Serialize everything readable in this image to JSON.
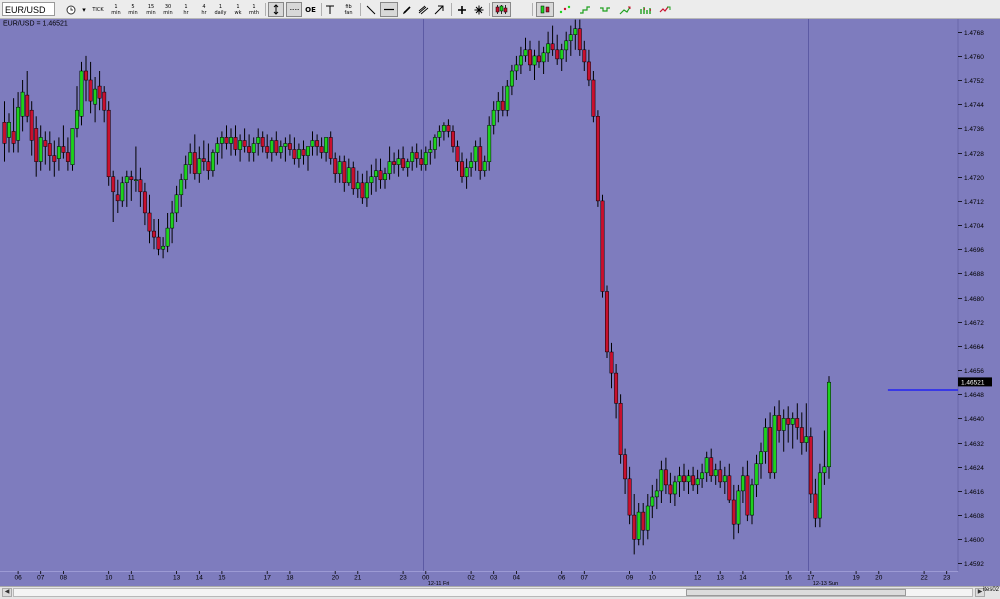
{
  "toolbar": {
    "symbol_value": "EUR/USD",
    "buttons": [
      {
        "name": "clock-icon",
        "label": ""
      },
      {
        "name": "dropdown-arrow-icon",
        "label": "▾"
      },
      {
        "name": "tick-button",
        "label": "TICK"
      },
      {
        "name": "1min-button",
        "label": "1\nmin"
      },
      {
        "name": "5min-button",
        "label": "5\nmin"
      },
      {
        "name": "15min-button",
        "label": "15\nmin"
      },
      {
        "name": "30min-button",
        "label": "30\nmin"
      },
      {
        "name": "1hr-button",
        "label": "1\nhr"
      },
      {
        "name": "4hr-button",
        "label": "4\nhr"
      },
      {
        "name": "1day-button",
        "label": "1\ndaily"
      },
      {
        "name": "1wk-button",
        "label": "1\nwk"
      },
      {
        "name": "1mth-button",
        "label": "1\nmth"
      }
    ],
    "oe_label": "OE",
    "fib_label": "fib\nfan"
  },
  "chart": {
    "title": "EUR/USD = 1.46521",
    "current_price_label": "1.46521",
    "corner_label": "ites02",
    "colors": {
      "background": "#7e7cbe",
      "up": "#1ed21e",
      "down": "#c8102e",
      "grid": "#8a88c8",
      "session_line": "#5c5aa4",
      "hline": "#1010ff"
    }
  },
  "chart_data": {
    "type": "candlestick",
    "title": "EUR/USD = 1.46521",
    "y_ticks": [
      1.4768,
      1.476,
      1.4752,
      1.4744,
      1.4736,
      1.4728,
      1.472,
      1.4712,
      1.4704,
      1.4696,
      1.4688,
      1.468,
      1.4672,
      1.4664,
      1.4656,
      1.4648,
      1.464,
      1.4632,
      1.4624,
      1.4616,
      1.4608,
      1.46,
      1.4592
    ],
    "ylim": [
      1.45895,
      1.47722
    ],
    "x_tick_labels": [
      {
        "label": "06",
        "slot": 3
      },
      {
        "label": "07",
        "slot": 8
      },
      {
        "label": "08",
        "slot": 13
      },
      {
        "label": "10",
        "slot": 23
      },
      {
        "label": "11",
        "slot": 28
      },
      {
        "label": "13",
        "slot": 38
      },
      {
        "label": "14",
        "slot": 43
      },
      {
        "label": "15",
        "slot": 48
      },
      {
        "label": "17",
        "slot": 58
      },
      {
        "label": "18",
        "slot": 63
      },
      {
        "label": "20",
        "slot": 73
      },
      {
        "label": "21",
        "slot": 78
      },
      {
        "label": "23",
        "slot": 88
      },
      {
        "label": "00",
        "slot": 93
      },
      {
        "label": "02",
        "slot": 103
      },
      {
        "label": "03",
        "slot": 108
      },
      {
        "label": "04",
        "slot": 113
      },
      {
        "label": "06",
        "slot": 123
      },
      {
        "label": "07",
        "slot": 128
      },
      {
        "label": "09",
        "slot": 138
      },
      {
        "label": "10",
        "slot": 143
      },
      {
        "label": "12",
        "slot": 153
      },
      {
        "label": "13",
        "slot": 158
      },
      {
        "label": "14",
        "slot": 163
      },
      {
        "label": "16",
        "slot": 173
      },
      {
        "label": "17",
        "slot": 178
      },
      {
        "label": "19",
        "slot": 188
      },
      {
        "label": "20",
        "slot": 193
      },
      {
        "label": "22",
        "slot": 203
      },
      {
        "label": "23",
        "slot": 208
      }
    ],
    "date_labels": [
      {
        "label": "12-11 Fri",
        "slot": 93
      },
      {
        "label": "12-13 Sun",
        "slot": 178
      }
    ],
    "session_separators": [
      92.3,
      177.3
    ],
    "current_price": 1.46521,
    "hline": {
      "y": 1.46494,
      "from_slot": 195,
      "to_slot": 211
    },
    "candles": [
      [
        1.4738,
        1.4745,
        1.4725,
        1.4731
      ],
      [
        1.4733,
        1.4741,
        1.4728,
        1.4738
      ],
      [
        1.4735,
        1.4746,
        1.4728,
        1.4731
      ],
      [
        1.4732,
        1.4748,
        1.4728,
        1.4743
      ],
      [
        1.474,
        1.4752,
        1.4735,
        1.4748
      ],
      [
        1.4747,
        1.4755,
        1.4738,
        1.474
      ],
      [
        1.4742,
        1.4745,
        1.4727,
        1.4732
      ],
      [
        1.4736,
        1.474,
        1.472,
        1.4725
      ],
      [
        1.4725,
        1.4737,
        1.4722,
        1.4733
      ],
      [
        1.4732,
        1.4735,
        1.4724,
        1.473
      ],
      [
        1.4731,
        1.4735,
        1.4722,
        1.4727
      ],
      [
        1.4727,
        1.4732,
        1.472,
        1.4725
      ],
      [
        1.4726,
        1.4733,
        1.4722,
        1.473
      ],
      [
        1.473,
        1.4737,
        1.4726,
        1.4728
      ],
      [
        1.4728,
        1.4733,
        1.4722,
        1.4725
      ],
      [
        1.4724,
        1.4736,
        1.4722,
        1.4736
      ],
      [
        1.4736,
        1.475,
        1.4733,
        1.4742
      ],
      [
        1.474,
        1.4758,
        1.4737,
        1.4755
      ],
      [
        1.4755,
        1.476,
        1.4745,
        1.4752
      ],
      [
        1.4752,
        1.4758,
        1.4741,
        1.4745
      ],
      [
        1.4744,
        1.4753,
        1.4738,
        1.4749
      ],
      [
        1.475,
        1.4755,
        1.4742,
        1.4746
      ],
      [
        1.4748,
        1.475,
        1.4738,
        1.4742
      ],
      [
        1.4742,
        1.4745,
        1.4717,
        1.472
      ],
      [
        1.472,
        1.4722,
        1.4705,
        1.4715
      ],
      [
        1.4714,
        1.4719,
        1.4708,
        1.4712
      ],
      [
        1.4712,
        1.472,
        1.471,
        1.4718
      ],
      [
        1.4718,
        1.4722,
        1.471,
        1.472
      ],
      [
        1.472,
        1.4722,
        1.4712,
        1.4719
      ],
      [
        1.4719,
        1.473,
        1.4715,
        1.4719
      ],
      [
        1.4719,
        1.4723,
        1.471,
        1.4715
      ],
      [
        1.4715,
        1.4718,
        1.4704,
        1.4708
      ],
      [
        1.4708,
        1.4714,
        1.4698,
        1.4702
      ],
      [
        1.4702,
        1.4706,
        1.4696,
        1.47
      ],
      [
        1.47,
        1.4706,
        1.4694,
        1.4696
      ],
      [
        1.4696,
        1.47,
        1.4693,
        1.4697
      ],
      [
        1.4697,
        1.4708,
        1.4695,
        1.4703
      ],
      [
        1.4703,
        1.4712,
        1.4698,
        1.4708
      ],
      [
        1.4708,
        1.4717,
        1.4705,
        1.4714
      ],
      [
        1.4714,
        1.4721,
        1.471,
        1.4719
      ],
      [
        1.4719,
        1.4727,
        1.4716,
        1.4724
      ],
      [
        1.4724,
        1.4731,
        1.4721,
        1.4728
      ],
      [
        1.4728,
        1.4734,
        1.4719,
        1.4721
      ],
      [
        1.4721,
        1.473,
        1.4718,
        1.4726
      ],
      [
        1.4726,
        1.4732,
        1.4722,
        1.4725
      ],
      [
        1.4725,
        1.4731,
        1.4719,
        1.4722
      ],
      [
        1.4722,
        1.4729,
        1.472,
        1.4728
      ],
      [
        1.4728,
        1.4733,
        1.4724,
        1.4731
      ],
      [
        1.4731,
        1.4735,
        1.4726,
        1.4733
      ],
      [
        1.4733,
        1.4737,
        1.4729,
        1.4731
      ],
      [
        1.4731,
        1.4736,
        1.4727,
        1.4733
      ],
      [
        1.4733,
        1.4737,
        1.4727,
        1.4729
      ],
      [
        1.4729,
        1.4734,
        1.4725,
        1.4732
      ],
      [
        1.4732,
        1.4736,
        1.4728,
        1.473
      ],
      [
        1.473,
        1.4734,
        1.4725,
        1.4728
      ],
      [
        1.4728,
        1.4733,
        1.4725,
        1.4731
      ],
      [
        1.4731,
        1.4736,
        1.4727,
        1.4733
      ],
      [
        1.4733,
        1.4735,
        1.4728,
        1.473
      ],
      [
        1.473,
        1.4734,
        1.4726,
        1.4728
      ],
      [
        1.4728,
        1.4733,
        1.4725,
        1.4732
      ],
      [
        1.4732,
        1.4735,
        1.4727,
        1.4728
      ],
      [
        1.4728,
        1.4732,
        1.4726,
        1.473
      ],
      [
        1.473,
        1.4733,
        1.4725,
        1.4731
      ],
      [
        1.4731,
        1.4734,
        1.4727,
        1.4729
      ],
      [
        1.4729,
        1.4733,
        1.4724,
        1.4726
      ],
      [
        1.4726,
        1.4731,
        1.4723,
        1.4729
      ],
      [
        1.4729,
        1.4732,
        1.4724,
        1.4727
      ],
      [
        1.4727,
        1.473,
        1.4722,
        1.473
      ],
      [
        1.473,
        1.4735,
        1.4727,
        1.4732
      ],
      [
        1.4732,
        1.4734,
        1.4727,
        1.473
      ],
      [
        1.473,
        1.4733,
        1.4726,
        1.4728
      ],
      [
        1.4728,
        1.4733,
        1.4725,
        1.4733
      ],
      [
        1.4733,
        1.4735,
        1.4724,
        1.4726
      ],
      [
        1.4726,
        1.4728,
        1.4718,
        1.4721
      ],
      [
        1.4721,
        1.4727,
        1.4718,
        1.4725
      ],
      [
        1.4725,
        1.4727,
        1.4715,
        1.4718
      ],
      [
        1.4718,
        1.4726,
        1.4717,
        1.4723
      ],
      [
        1.4723,
        1.4725,
        1.4714,
        1.4716
      ],
      [
        1.4716,
        1.4722,
        1.4713,
        1.4718
      ],
      [
        1.4718,
        1.4721,
        1.4711,
        1.4713
      ],
      [
        1.4713,
        1.4722,
        1.471,
        1.4718
      ],
      [
        1.4718,
        1.4724,
        1.4714,
        1.472
      ],
      [
        1.472,
        1.4726,
        1.4715,
        1.4722
      ],
      [
        1.4722,
        1.4726,
        1.4716,
        1.4719
      ],
      [
        1.4719,
        1.4723,
        1.4716,
        1.4721
      ],
      [
        1.4721,
        1.473,
        1.4719,
        1.4725
      ],
      [
        1.4725,
        1.4728,
        1.4721,
        1.4724
      ],
      [
        1.4724,
        1.4729,
        1.472,
        1.4726
      ],
      [
        1.4726,
        1.473,
        1.4722,
        1.4723
      ],
      [
        1.4723,
        1.4726,
        1.472,
        1.4725
      ],
      [
        1.4725,
        1.473,
        1.4722,
        1.4728
      ],
      [
        1.4728,
        1.4731,
        1.4723,
        1.4726
      ],
      [
        1.4726,
        1.4729,
        1.4722,
        1.4724
      ],
      [
        1.4724,
        1.473,
        1.4722,
        1.4728
      ],
      [
        1.4728,
        1.4732,
        1.4724,
        1.4729
      ],
      [
        1.4729,
        1.4734,
        1.4726,
        1.4733
      ],
      [
        1.4733,
        1.4737,
        1.473,
        1.4735
      ],
      [
        1.4735,
        1.4738,
        1.4732,
        1.4737
      ],
      [
        1.4737,
        1.4739,
        1.4733,
        1.4735
      ],
      [
        1.4735,
        1.4737,
        1.4728,
        1.473
      ],
      [
        1.473,
        1.4732,
        1.4722,
        1.4725
      ],
      [
        1.4725,
        1.4728,
        1.4718,
        1.472
      ],
      [
        1.472,
        1.4726,
        1.4716,
        1.4723
      ],
      [
        1.4723,
        1.4728,
        1.472,
        1.4725
      ],
      [
        1.4725,
        1.4732,
        1.4722,
        1.473
      ],
      [
        1.473,
        1.4733,
        1.4719,
        1.4722
      ],
      [
        1.4722,
        1.4727,
        1.472,
        1.4725
      ],
      [
        1.4725,
        1.474,
        1.4722,
        1.4737
      ],
      [
        1.4737,
        1.4745,
        1.4734,
        1.4742
      ],
      [
        1.4742,
        1.4748,
        1.4738,
        1.4745
      ],
      [
        1.4745,
        1.475,
        1.474,
        1.4742
      ],
      [
        1.4742,
        1.4752,
        1.474,
        1.475
      ],
      [
        1.475,
        1.4757,
        1.4747,
        1.4755
      ],
      [
        1.4755,
        1.476,
        1.4752,
        1.4757
      ],
      [
        1.4757,
        1.4763,
        1.4754,
        1.476
      ],
      [
        1.476,
        1.4766,
        1.4758,
        1.4762
      ],
      [
        1.4762,
        1.4765,
        1.4755,
        1.4757
      ],
      [
        1.4757,
        1.4762,
        1.4752,
        1.476
      ],
      [
        1.476,
        1.4765,
        1.4756,
        1.4758
      ],
      [
        1.4758,
        1.4763,
        1.4754,
        1.4761
      ],
      [
        1.4761,
        1.4768,
        1.4758,
        1.4764
      ],
      [
        1.4764,
        1.477,
        1.476,
        1.4762
      ],
      [
        1.4762,
        1.4767,
        1.4757,
        1.4759
      ],
      [
        1.4759,
        1.4764,
        1.4755,
        1.4762
      ],
      [
        1.4762,
        1.4768,
        1.4758,
        1.4765
      ],
      [
        1.4765,
        1.477,
        1.476,
        1.4767
      ],
      [
        1.4767,
        1.4772,
        1.4762,
        1.4769
      ],
      [
        1.4769,
        1.4772,
        1.476,
        1.4762
      ],
      [
        1.4762,
        1.4765,
        1.4755,
        1.4758
      ],
      [
        1.4758,
        1.4762,
        1.475,
        1.4752
      ],
      [
        1.4752,
        1.4755,
        1.4738,
        1.474
      ],
      [
        1.474,
        1.4742,
        1.471,
        1.4712
      ],
      [
        1.4712,
        1.4714,
        1.468,
        1.4682
      ],
      [
        1.4682,
        1.4684,
        1.466,
        1.4662
      ],
      [
        1.4662,
        1.4665,
        1.465,
        1.4655
      ],
      [
        1.4655,
        1.4658,
        1.464,
        1.4645
      ],
      [
        1.4645,
        1.4648,
        1.4625,
        1.4628
      ],
      [
        1.4628,
        1.463,
        1.4615,
        1.462
      ],
      [
        1.462,
        1.4624,
        1.4605,
        1.4608
      ],
      [
        1.4608,
        1.4615,
        1.4595,
        1.46
      ],
      [
        1.46,
        1.4612,
        1.4598,
        1.4609
      ],
      [
        1.4609,
        1.4612,
        1.4598,
        1.4603
      ],
      [
        1.4603,
        1.4615,
        1.46,
        1.4611
      ],
      [
        1.4611,
        1.4618,
        1.4607,
        1.4614
      ],
      [
        1.4614,
        1.462,
        1.461,
        1.4616
      ],
      [
        1.4616,
        1.4626,
        1.4612,
        1.4623
      ],
      [
        1.4623,
        1.4627,
        1.4615,
        1.4618
      ],
      [
        1.4618,
        1.4622,
        1.4612,
        1.4615
      ],
      [
        1.4615,
        1.4621,
        1.4611,
        1.4619
      ],
      [
        1.4619,
        1.4624,
        1.4614,
        1.4621
      ],
      [
        1.4621,
        1.4625,
        1.4616,
        1.4619
      ],
      [
        1.4619,
        1.4623,
        1.4615,
        1.4621
      ],
      [
        1.4621,
        1.4624,
        1.4616,
        1.4618
      ],
      [
        1.4618,
        1.4623,
        1.4615,
        1.462
      ],
      [
        1.462,
        1.4625,
        1.4617,
        1.4622
      ],
      [
        1.4622,
        1.4629,
        1.4619,
        1.4627
      ],
      [
        1.4627,
        1.463,
        1.4619,
        1.4621
      ],
      [
        1.4621,
        1.4625,
        1.4618,
        1.4623
      ],
      [
        1.4623,
        1.4626,
        1.4617,
        1.4619
      ],
      [
        1.4619,
        1.4624,
        1.4615,
        1.4621
      ],
      [
        1.4621,
        1.4625,
        1.4612,
        1.4613
      ],
      [
        1.4613,
        1.4618,
        1.46,
        1.4605
      ],
      [
        1.4605,
        1.4618,
        1.4602,
        1.4616
      ],
      [
        1.4616,
        1.4624,
        1.4612,
        1.4621
      ],
      [
        1.4621,
        1.4626,
        1.4606,
        1.4608
      ],
      [
        1.4608,
        1.462,
        1.4605,
        1.4618
      ],
      [
        1.4618,
        1.4628,
        1.4614,
        1.4625
      ],
      [
        1.4625,
        1.4632,
        1.462,
        1.4629
      ],
      [
        1.4629,
        1.464,
        1.4625,
        1.4637
      ],
      [
        1.4637,
        1.4642,
        1.462,
        1.4622
      ],
      [
        1.4622,
        1.4644,
        1.462,
        1.4641
      ],
      [
        1.4641,
        1.4646,
        1.4632,
        1.4636
      ],
      [
        1.4636,
        1.4643,
        1.4629,
        1.464
      ],
      [
        1.464,
        1.4644,
        1.4632,
        1.4638
      ],
      [
        1.4638,
        1.4642,
        1.463,
        1.464
      ],
      [
        1.464,
        1.4645,
        1.4633,
        1.4637
      ],
      [
        1.4637,
        1.4642,
        1.4628,
        1.4632
      ],
      [
        1.4632,
        1.4645,
        1.4629,
        1.4634
      ],
      [
        1.4634,
        1.4637,
        1.4612,
        1.4615
      ],
      [
        1.4615,
        1.462,
        1.4604,
        1.4607
      ],
      [
        1.4607,
        1.4625,
        1.4604,
        1.4622
      ],
      [
        1.4622,
        1.4636,
        1.4618,
        1.4624
      ],
      [
        1.4624,
        1.4654,
        1.462,
        1.4652
      ]
    ]
  }
}
